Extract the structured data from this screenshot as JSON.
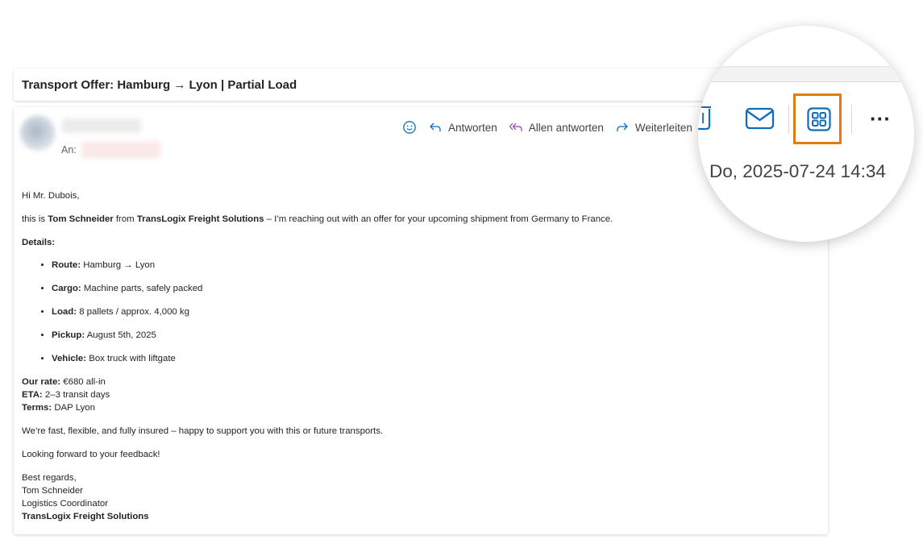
{
  "subject": "Transport Offer: Hamburg → Lyon | Partial Load",
  "header": {
    "to_label": "An:"
  },
  "actions": {
    "reply": "Antworten",
    "reply_all": "Allen antworten",
    "forward": "Weiterleiten"
  },
  "icons": {
    "emoji": "emoji-icon",
    "reply": "reply-icon",
    "reply_all": "reply-all-icon",
    "forward": "forward-icon",
    "trash": "trash-icon",
    "mail": "mail-icon",
    "apps": "apps-icon",
    "more": "more-icon"
  },
  "body": {
    "greeting": "Hi Mr. Dubois,",
    "intro_pre": "this is ",
    "intro_name": "Tom Schneider",
    "intro_mid": " from ",
    "intro_company": "TransLogix Freight Solutions",
    "intro_post": " – I’m reaching out with an offer for your upcoming shipment from Germany to France.",
    "details_heading": "Details:",
    "details": [
      {
        "label": "Route:",
        "value": "Hamburg → Lyon"
      },
      {
        "label": "Cargo:",
        "value": "Machine parts, safely packed"
      },
      {
        "label": "Load:",
        "value": "8 pallets / approx. 4,000 kg"
      },
      {
        "label": "Pickup:",
        "value": "August 5th, 2025"
      },
      {
        "label": "Vehicle:",
        "value": "Box truck with liftgate"
      }
    ],
    "rate_label": "Our rate:",
    "rate_value": "€680 all-in",
    "eta_label": "ETA:",
    "eta_value": "2–3 transit days",
    "terms_label": "Terms:",
    "terms_value": "DAP Lyon",
    "closing_line": "We’re fast, flexible, and fully insured – happy to support you with this or future transports.",
    "looking_forward": "Looking forward to your feedback!",
    "regards": "Best regards,",
    "sig_name": "Tom Schneider",
    "sig_title": "Logistics Coordinator",
    "sig_company": "TransLogix Freight Solutions"
  },
  "zoom": {
    "more_label": "···",
    "date": "Do, 2025-07-24 14:34"
  },
  "colors": {
    "accent": "#0f6cbd",
    "highlight": "#e07d10",
    "reply_all_icon": "#8e44ad"
  }
}
